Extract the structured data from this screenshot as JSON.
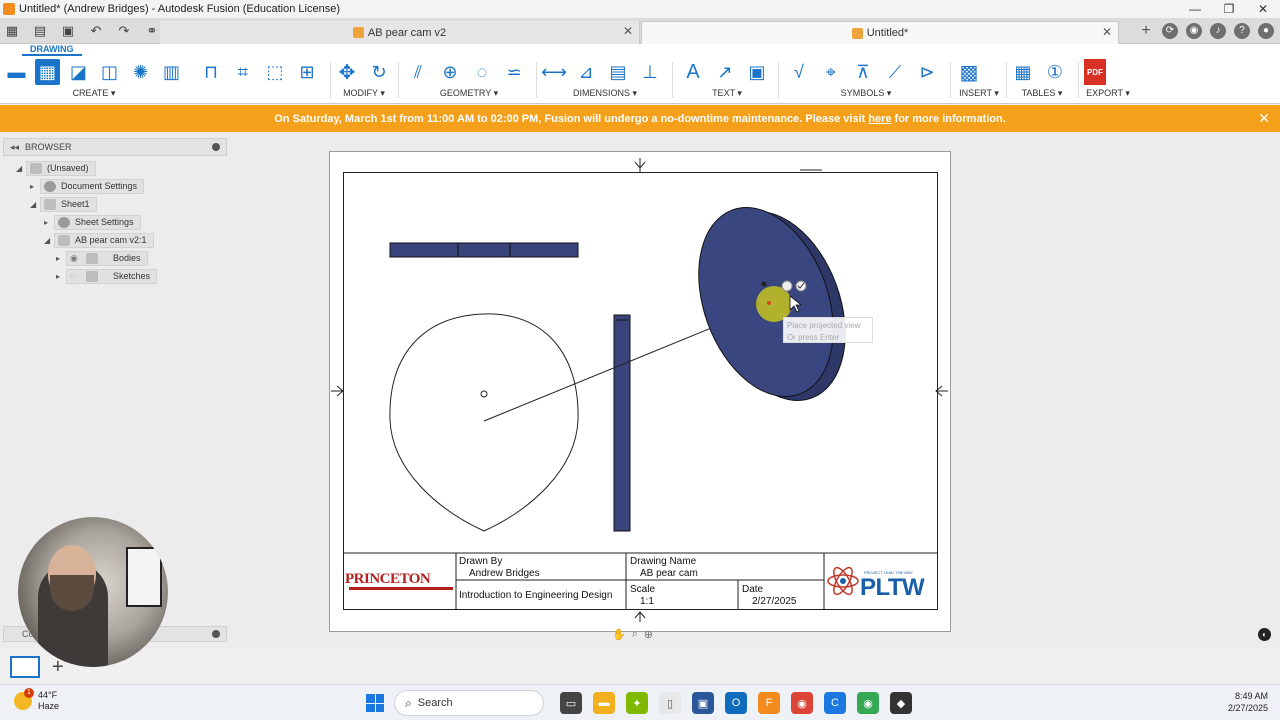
{
  "window": {
    "title": "Untitled* (Andrew Bridges) - Autodesk Fusion (Education License)",
    "controls": {
      "minimize": "—",
      "maximize": "❐",
      "close": "✕"
    }
  },
  "tabs": [
    {
      "label": "AB pear cam v2",
      "active": false
    },
    {
      "label": "Untitled*",
      "active": true
    }
  ],
  "ribbon": {
    "workspace_tab": "DRAWING",
    "groups": {
      "create": "CREATE ▾",
      "modify": "MODIFY ▾",
      "geometry": "GEOMETRY ▾",
      "dimensions": "DIMENSIONS ▾",
      "text": "TEXT ▾",
      "symbols": "SYMBOLS ▾",
      "insert": "INSERT ▾",
      "tables": "TABLES ▾",
      "export": "EXPORT ▾"
    },
    "pdf_label": "PDF",
    "text_glyph": "A"
  },
  "banner": {
    "text_before": "On Saturday, March 1st from 11:00 AM to 02:00 PM, Fusion will undergo a no-downtime maintenance. Please visit",
    "link": "here",
    "text_after": "for more information.",
    "close": "✕"
  },
  "browser": {
    "title": "BROWSER",
    "collapse_glyph": "◂◂",
    "items": [
      {
        "label": "(Unsaved)"
      },
      {
        "label": "Document Settings"
      },
      {
        "label": "Sheet1"
      },
      {
        "label": "Sheet Settings"
      },
      {
        "label": "AB pear cam v2:1"
      },
      {
        "label": "Bodies"
      },
      {
        "label": "Sketches"
      }
    ]
  },
  "comments": {
    "label": "Co"
  },
  "tooltip": {
    "line1": "Place projected view",
    "line2": "Or press Enter"
  },
  "title_block": {
    "drawn_by_label": "Drawn By",
    "drawn_by": "Andrew Bridges",
    "course": "Introduction to Engineering Design",
    "drawing_name_label": "Drawing Name",
    "drawing_name": "AB pear cam",
    "scale_label": "Scale",
    "scale": "1:1",
    "date_label": "Date",
    "date": "2/27/2025",
    "school_logo": "PRINCETON",
    "partner_logo": "PLTW",
    "partner_tagline": "PROJECT LEAD THE WAY"
  },
  "taskbar": {
    "temp": "44°F",
    "condition": "Haze",
    "weather_alert": "1",
    "search_label": "Search",
    "time": "8:49 AM",
    "date": "2/27/2025"
  },
  "colors": {
    "accent": "#1a74c9",
    "banner": "#f5a01a",
    "part_fill": "#38447a",
    "cursor_highlight": "#c8c41e"
  }
}
